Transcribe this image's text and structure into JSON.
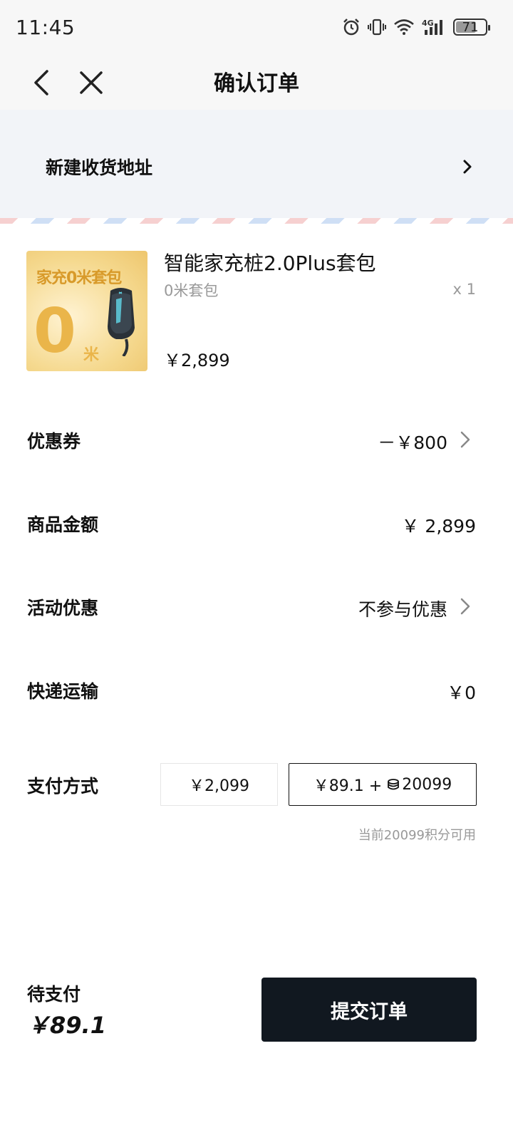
{
  "status_bar": {
    "time": "11:45",
    "battery": "71",
    "network": "4G"
  },
  "nav": {
    "title": "确认订单"
  },
  "address": {
    "label": "新建收货地址"
  },
  "product": {
    "name": "智能家充桩2.0Plus套包",
    "spec": "0米套包",
    "qty": "x 1",
    "price": "￥2,899",
    "image_label": "家充0米套包",
    "image_big": "0",
    "image_small": "米"
  },
  "rows": {
    "coupon": {
      "label": "优惠券",
      "value": "－￥800"
    },
    "goods_amount": {
      "label": "商品金额",
      "value": "￥ 2,899"
    },
    "promotion": {
      "label": "活动优惠",
      "value": "不参与优惠"
    },
    "shipping": {
      "label": "快递运输",
      "value": "￥0"
    }
  },
  "payment": {
    "label": "支付方式",
    "option_cash": "￥2,099",
    "option_mixed_price": "￥89.1 +",
    "option_mixed_points": "20099",
    "selected": "option_mixed",
    "points_note": "当前20099积分可用"
  },
  "footer": {
    "pending_label": "待支付",
    "pending_amount": "￥89.1",
    "submit_label": "提交订单"
  },
  "colors": {
    "primary_button": "#111820",
    "address_bg": "#f2f4f8",
    "muted_text": "#999999"
  }
}
